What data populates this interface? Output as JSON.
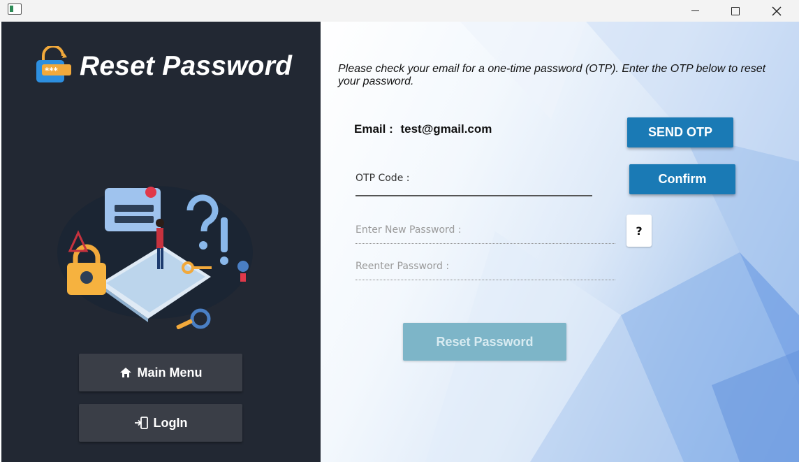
{
  "window": {
    "minimize_icon": "minimize-icon",
    "maximize_icon": "maximize-icon",
    "close_icon": "close-icon"
  },
  "sidebar": {
    "title": "Reset Password",
    "logo_icon": "lock-password-icon",
    "main_menu_label": "Main Menu",
    "main_menu_icon": "home-icon",
    "login_label": "LogIn",
    "login_icon": "login-icon"
  },
  "form": {
    "instructions": "Please check your email for a one-time password (OTP). Enter the OTP below to reset your password.",
    "email_label": "Email :",
    "email_value": "test@gmail.com",
    "send_otp_label": "SEND OTP",
    "otp_placeholder": "OTP Code :",
    "confirm_label": "Confirm",
    "new_password_placeholder": "Enter New Password :",
    "help_label": "?",
    "reenter_placeholder": "Reenter Password :",
    "reset_label": "Reset Password"
  },
  "colors": {
    "sidebar_bg": "#222833",
    "button_dark": "#3a3e47",
    "primary": "#1a7ab5",
    "reset_disabled": "#7db5c8"
  }
}
